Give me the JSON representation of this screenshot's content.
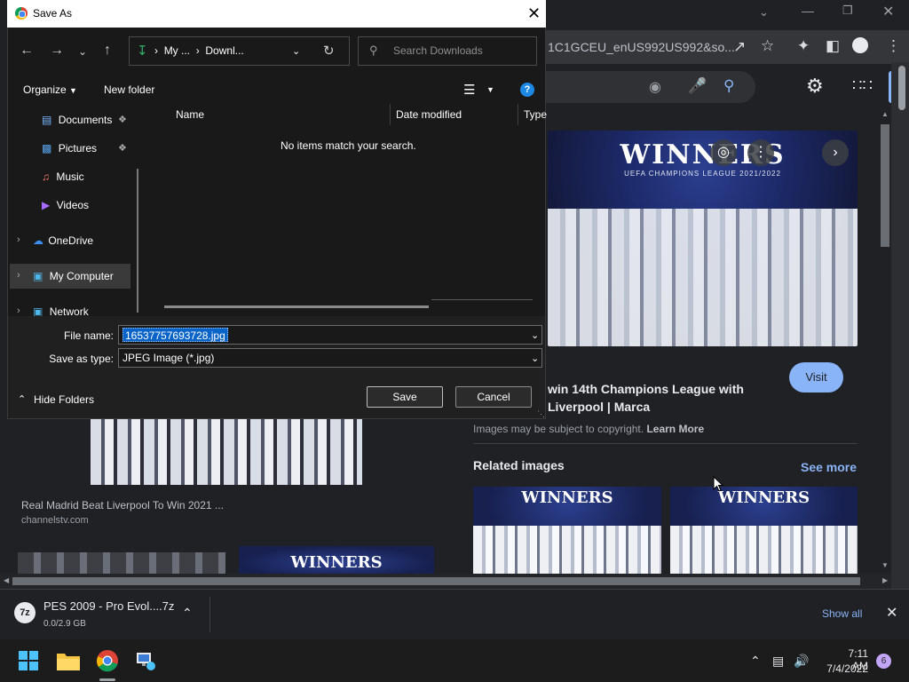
{
  "chrome": {
    "url_fragment": "1C1GCEU_enUS992US992&so...",
    "window_controls": [
      "chevron-down-icon",
      "minimize-icon",
      "restore-icon",
      "close-icon"
    ]
  },
  "dialog": {
    "title": "Save As",
    "address_prefix": "My ...",
    "address_current": "Downl...",
    "search_placeholder": "Search Downloads",
    "organize_label": "Organize",
    "new_folder_label": "New folder",
    "nav_items": [
      {
        "label": "Documents",
        "icon": "documents-icon",
        "pinned": true
      },
      {
        "label": "Pictures",
        "icon": "pictures-icon",
        "pinned": true
      },
      {
        "label": "Music",
        "icon": "music-icon",
        "pinned": false
      },
      {
        "label": "Videos",
        "icon": "videos-icon",
        "pinned": false
      },
      {
        "label": "OneDrive",
        "icon": "cloud-icon",
        "pinned": false
      },
      {
        "label": "My Computer",
        "icon": "computer-icon",
        "pinned": false
      },
      {
        "label": "Network",
        "icon": "network-icon",
        "pinned": false
      }
    ],
    "columns": [
      "Name",
      "Date modified",
      "Type"
    ],
    "empty_message": "No items match your search.",
    "file_name_label": "File name:",
    "file_name_value": "16537757693728.jpg",
    "save_type_label": "Save as type:",
    "save_type_value": "JPEG Image (*.jpg)",
    "hide_folders_label": "Hide Folders",
    "save_label": "Save",
    "cancel_label": "Cancel"
  },
  "page": {
    "hero_title": "WINNERS",
    "hero_subtitle": "UEFA CHAMPIONS LEAGUE 2021/2022",
    "result_title": "win 14th Champions League with Liverpool | Marca",
    "visit_label": "Visit",
    "copyright_text": "Images may be subject to copyright.",
    "learn_more": "Learn More",
    "related_label": "Related images",
    "see_more_label": "See more",
    "thumb_title": "WINNERS",
    "left_caption": "Real Madrid Beat Liverpool To Win 2021 ...",
    "left_source": "channelstv.com",
    "left_thumb_title": "WINNERS"
  },
  "download": {
    "file_name": "PES 2009 - Pro Evol....7z",
    "progress": "0.0/2.9 GB",
    "show_all": "Show all"
  },
  "taskbar": {
    "time": "7:11 AM",
    "date": "7/4/2022",
    "notification_count": "6"
  },
  "colors": {
    "accent": "#8ab4f8",
    "selection": "#0a64c8",
    "dialog_bg": "#191919"
  }
}
